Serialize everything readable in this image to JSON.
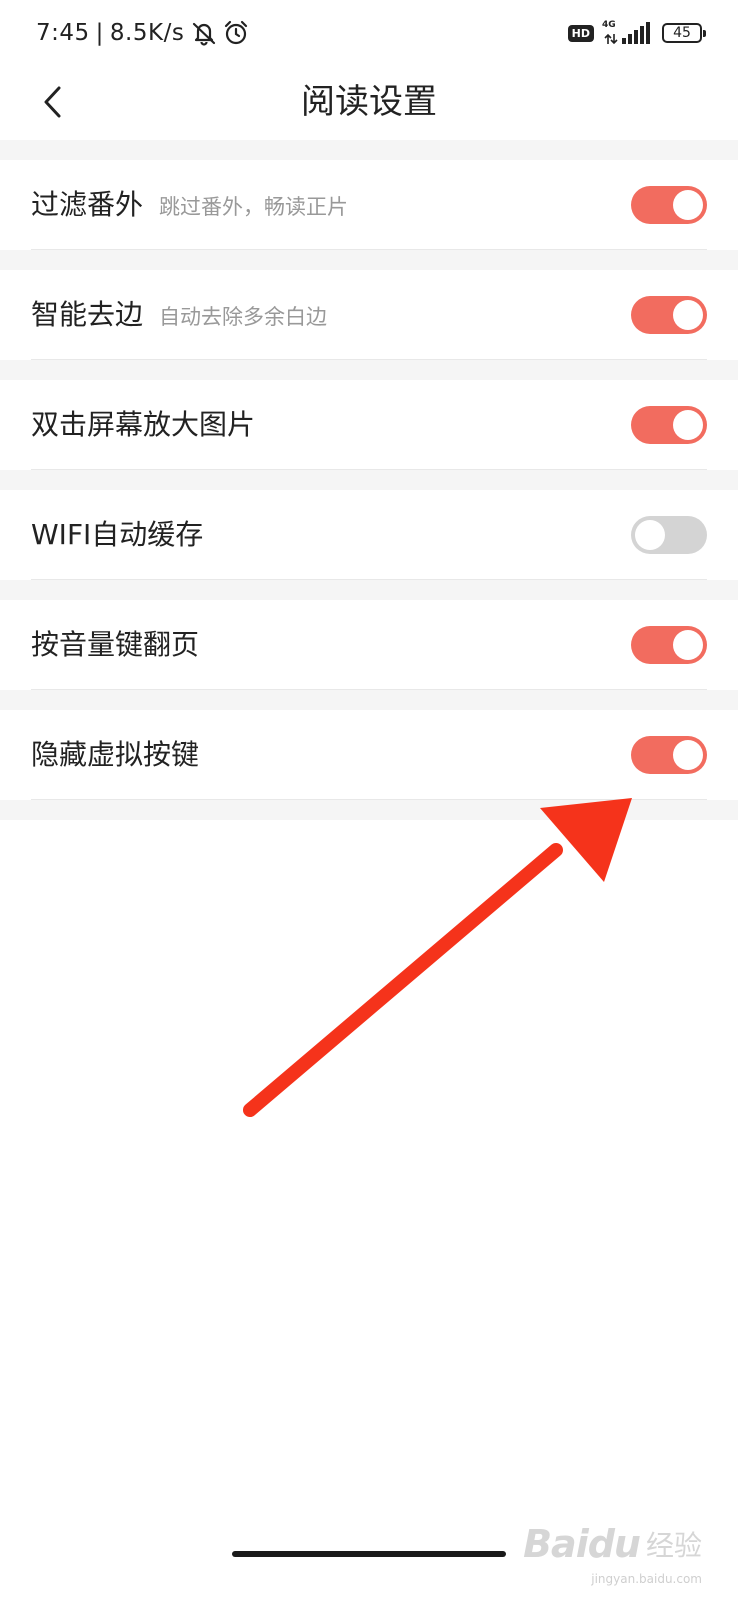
{
  "status_bar": {
    "time": "7:45",
    "separator": "|",
    "net_speed": "8.5K/s",
    "hd_label": "HD",
    "network_type": "4G",
    "battery_level": "45"
  },
  "header": {
    "title": "阅读设置"
  },
  "settings": [
    {
      "title": "过滤番外",
      "description": "跳过番外，畅读正片",
      "enabled": true
    },
    {
      "title": "智能去边",
      "description": "自动去除多余白边",
      "enabled": true
    },
    {
      "title": "双击屏幕放大图片",
      "description": "",
      "enabled": true
    },
    {
      "title": "WIFI自动缓存",
      "description": "",
      "enabled": false
    },
    {
      "title": "按音量键翻页",
      "description": "",
      "enabled": true
    },
    {
      "title": "隐藏虚拟按键",
      "description": "",
      "enabled": true
    }
  ],
  "watermark": {
    "logo_text": "Baidu",
    "cn_text": "经验",
    "url": "jingyan.baidu.com"
  },
  "colors": {
    "toggle_on": "#f26c5f",
    "toggle_off": "#d4d4d4",
    "annotation_arrow": "#f5331b"
  },
  "icons": {
    "back": "chevron-left-icon",
    "mute": "bell-off-icon",
    "alarm": "alarm-clock-icon",
    "signal": "signal-bars-icon",
    "battery": "battery-icon"
  }
}
